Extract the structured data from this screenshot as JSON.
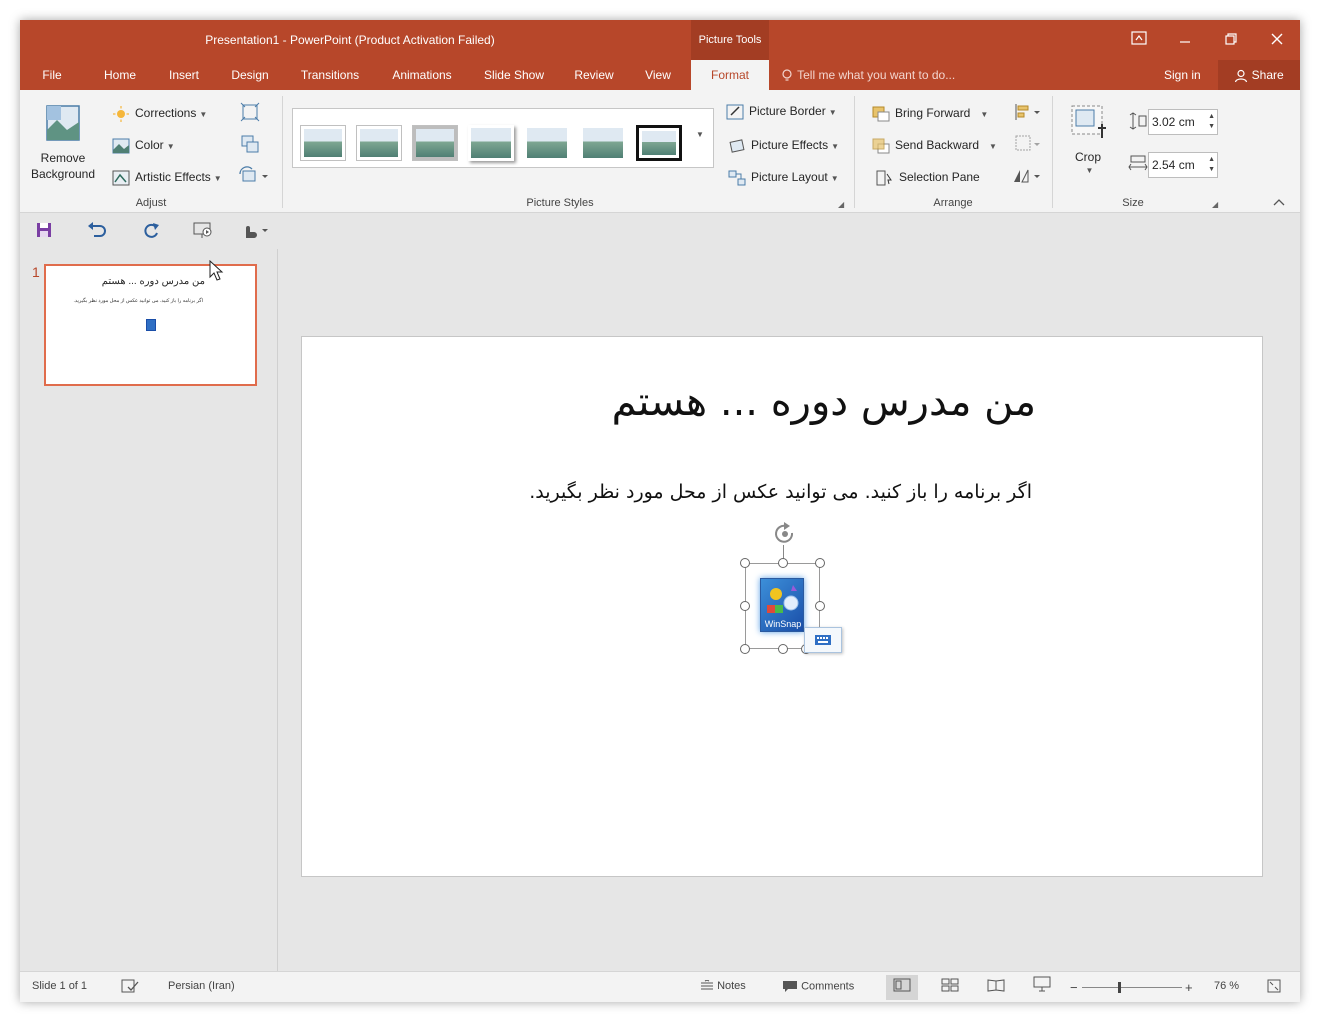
{
  "window": {
    "title": "Presentation1 - PowerPoint (Product Activation Failed)",
    "context_tab": "Picture Tools",
    "accent": "#b7472a"
  },
  "tabs": [
    "File",
    "Home",
    "Insert",
    "Design",
    "Transitions",
    "Animations",
    "Slide Show",
    "Review",
    "View",
    "Format"
  ],
  "active_tab": "Format",
  "tell_me": "Tell me what you want to do...",
  "sign_in": "Sign in",
  "share": "Share",
  "ribbon": {
    "adjust": {
      "remove_background": "Remove Background",
      "corrections": "Corrections",
      "color": "Color",
      "artistic_effects": "Artistic Effects",
      "label": "Adjust"
    },
    "picture_styles": {
      "label": "Picture Styles",
      "picture_border": "Picture Border",
      "picture_effects": "Picture Effects",
      "picture_layout": "Picture Layout"
    },
    "arrange": {
      "label": "Arrange",
      "bring_forward": "Bring Forward",
      "send_backward": "Send Backward",
      "selection_pane": "Selection Pane"
    },
    "size": {
      "label": "Size",
      "crop": "Crop",
      "height": "3.02 cm",
      "width": "2.54 cm"
    }
  },
  "thumbnail": {
    "number": "1",
    "title": "من مدرس دوره ... هستم",
    "body": "اگر برنامه را باز کنید. می توانید عکس از محل مورد نظر بگیرید."
  },
  "slide": {
    "title": "من مدرس دوره ... هستم",
    "body": "اگر برنامه را باز کنید. می توانید عکس از محل مورد نظر بگیرید.",
    "picture_label": "WinSnap"
  },
  "status": {
    "slide_info": "Slide 1 of 1",
    "language": "Persian (Iran)",
    "notes": "Notes",
    "comments": "Comments",
    "zoom": "76 %"
  }
}
